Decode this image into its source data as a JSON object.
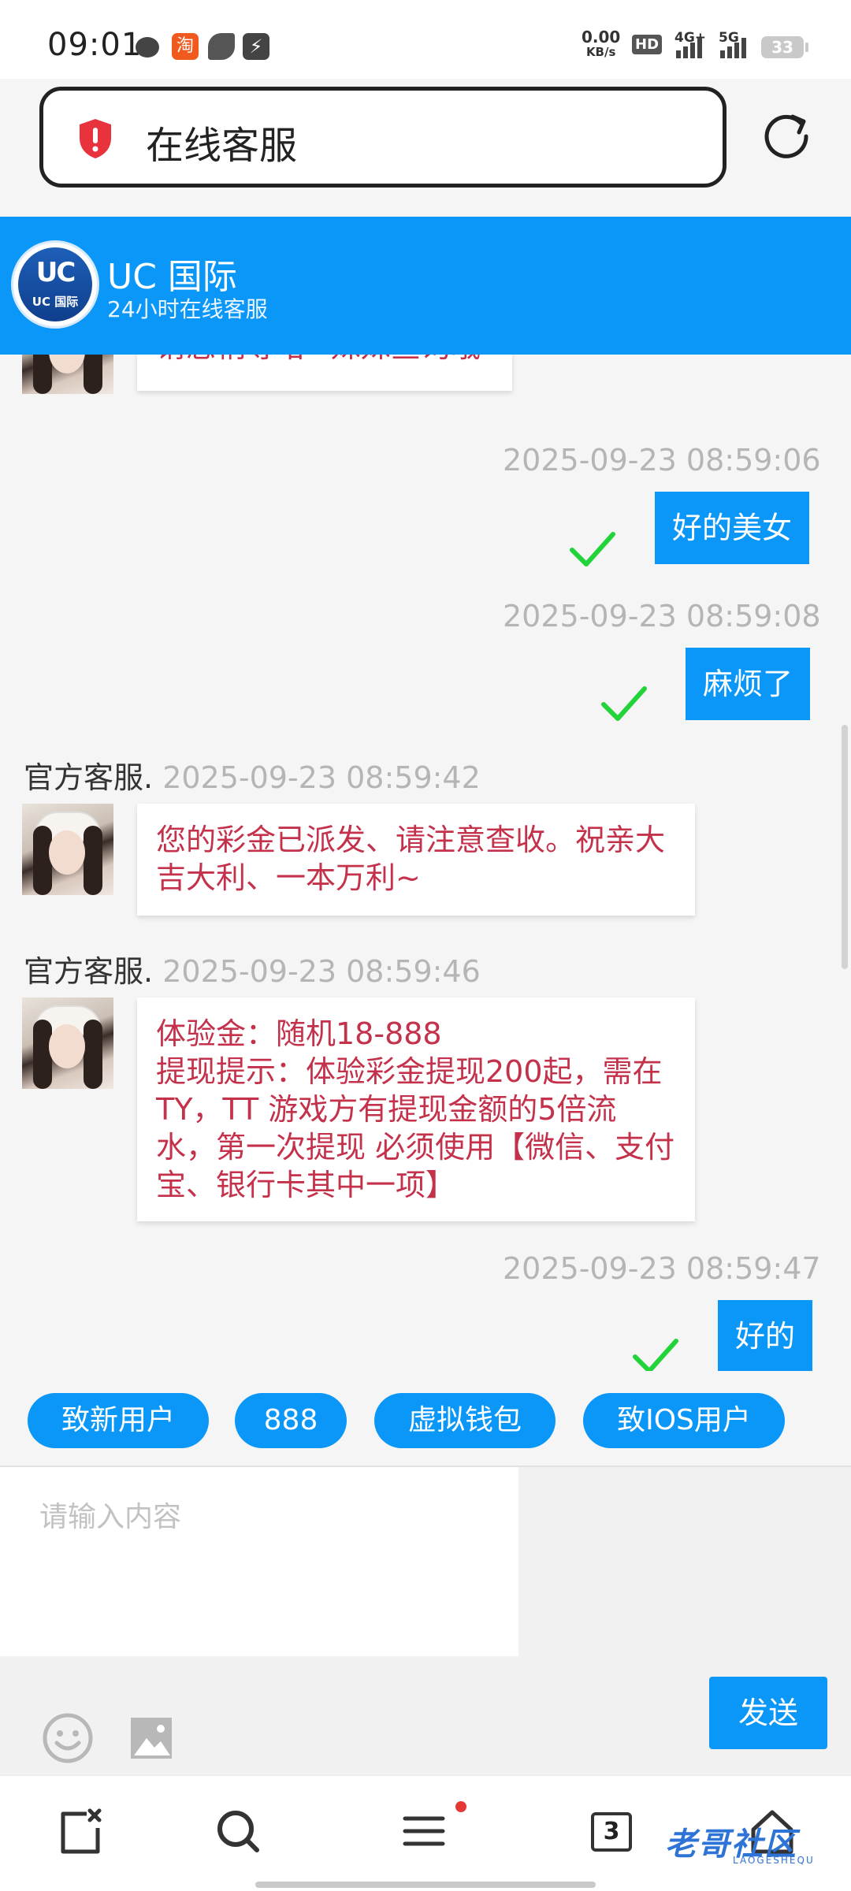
{
  "status_bar": {
    "time": "09:01",
    "speed_value": "0.00",
    "speed_unit": "KB/s",
    "hd_label": "HD",
    "network_1": "4G+",
    "network_2": "5G",
    "battery": "33"
  },
  "address_bar": {
    "title": "在线客服"
  },
  "header": {
    "logo_letters": "UC",
    "logo_text": "UC 国际",
    "title": "UC 国际",
    "subtitle": "24小时在线客服"
  },
  "messages": {
    "m0": {
      "text": "请您稍等哈~妹妹查询哦"
    },
    "m1": {
      "timestamp": "2025-09-23 08:59:06",
      "text": "好的美女"
    },
    "m2": {
      "timestamp": "2025-09-23 08:59:08",
      "text": "麻烦了"
    },
    "m3": {
      "sender": "官方客服.",
      "timestamp": "2025-09-23 08:59:42",
      "text": "您的彩金已派发、请注意查收。祝亲大吉大利、一本万利~"
    },
    "m4": {
      "sender": "官方客服.",
      "timestamp": "2025-09-23 08:59:46",
      "text": "体验金：随机18-888\n提现提示：体验彩金提现200起，需在 TY，TT 游戏方有提现金额的5倍流水，第一次提现 必须使用【微信、支付宝、银行卡其中一项】"
    },
    "m5": {
      "timestamp": "2025-09-23 08:59:47",
      "text": "好的"
    }
  },
  "quick_replies": [
    "致新用户",
    "888",
    "虚拟钱包",
    "致IOS用户"
  ],
  "composer": {
    "placeholder": "请输入内容",
    "send_label": "发送"
  },
  "bottom_nav": {
    "tab_count": "3",
    "watermark": "老哥社区",
    "watermark_sub": "LAOGESHEQU"
  },
  "colors": {
    "accent": "#0a97f7",
    "incoming_text": "#c4314b",
    "check": "#22d33a",
    "notification_dot": "#e53935"
  },
  "icons": [
    "wechat-icon",
    "taobao-icon",
    "leaf-icon",
    "bolt-icon",
    "shield-icon",
    "refresh-icon",
    "check-icon",
    "emoji-icon",
    "image-icon",
    "close-tab-icon",
    "search-icon",
    "menu-icon",
    "home-icon"
  ]
}
